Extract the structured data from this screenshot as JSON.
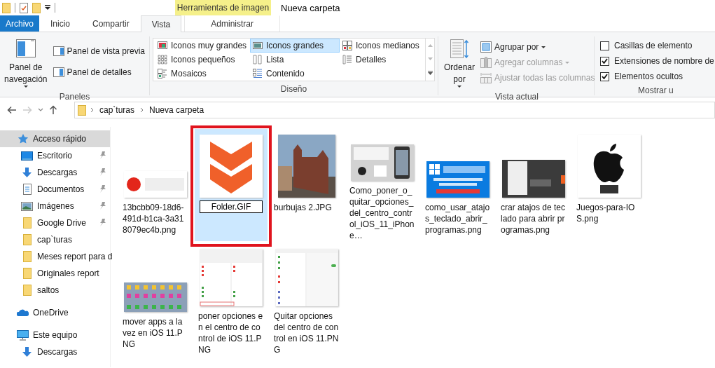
{
  "window": {
    "title": "Nueva carpeta"
  },
  "contextual_tab_group": {
    "title": "Herramientas de imagen"
  },
  "tabs": [
    {
      "label": "Archivo",
      "kind": "file",
      "selected": false
    },
    {
      "label": "Inicio",
      "kind": "normal",
      "selected": false
    },
    {
      "label": "Compartir",
      "kind": "normal",
      "selected": false
    },
    {
      "label": "Vista",
      "kind": "normal",
      "selected": true
    },
    {
      "label": "Administrar",
      "kind": "contextual",
      "selected": false
    }
  ],
  "ribbon_groups": [
    {
      "kind": "panes",
      "label": "Paneles",
      "large_button": "Panel de navegación",
      "buttons": [
        "Panel de vista previa",
        "Panel de detalles"
      ]
    },
    {
      "kind": "layout",
      "label": "Diseño",
      "options": [
        {
          "label": "Iconos muy grandes",
          "selected": false
        },
        {
          "label": "Iconos grandes",
          "selected": true
        },
        {
          "label": "Iconos medianos",
          "selected": false
        },
        {
          "label": "Iconos pequeños",
          "selected": false
        },
        {
          "label": "Lista",
          "selected": false
        },
        {
          "label": "Detalles",
          "selected": false
        },
        {
          "label": "Mosaicos",
          "selected": false
        },
        {
          "label": "Contenido",
          "selected": false
        }
      ]
    },
    {
      "kind": "current_view",
      "label": "Vista actual",
      "large_button": "Ordenar por",
      "buttons": [
        {
          "label": "Agrupar por",
          "disabled": false,
          "dropdown": true
        },
        {
          "label": "Agregar columnas",
          "disabled": true,
          "dropdown": true
        },
        {
          "label": "Ajustar todas las columnas",
          "disabled": true,
          "dropdown": false
        }
      ]
    },
    {
      "kind": "show_hide",
      "label": "Mostrar u",
      "checkboxes": [
        {
          "label": "Casillas de elemento",
          "checked": false
        },
        {
          "label": "Extensiones de nombre de",
          "checked": true
        },
        {
          "label": "Elementos ocultos",
          "checked": true
        }
      ]
    }
  ],
  "address_bar": {
    "path": [
      "cap`turas",
      "Nueva carpeta"
    ]
  },
  "navigation_pane": {
    "items": [
      {
        "label": "Acceso rápido",
        "kind": "star",
        "selected": true,
        "children": [
          {
            "label": "Escritorio",
            "kind": "desktop",
            "pinned": true,
            "selected": false
          },
          {
            "label": "Descargas",
            "kind": "download",
            "pinned": true,
            "selected": false
          },
          {
            "label": "Documentos",
            "kind": "document",
            "pinned": true,
            "selected": false
          },
          {
            "label": "Imágenes",
            "kind": "pictures",
            "pinned": true,
            "selected": false
          },
          {
            "label": "Google Drive",
            "kind": "folder",
            "pinned": true,
            "selected": false
          },
          {
            "label": "cap`turas",
            "kind": "folder",
            "pinned": false,
            "selected": false
          },
          {
            "label": "Meses report para d",
            "kind": "folder",
            "pinned": false,
            "selected": false
          },
          {
            "label": "Originales report",
            "kind": "folder",
            "pinned": false,
            "selected": false
          },
          {
            "label": "saltos",
            "kind": "folder",
            "pinned": false,
            "selected": false
          }
        ]
      },
      {
        "label": "OneDrive",
        "kind": "cloud",
        "selected": false
      },
      {
        "label": "Este equipo",
        "kind": "computer",
        "selected": false,
        "children": [
          {
            "label": "Descargas",
            "kind": "download",
            "pinned": false,
            "selected": false
          }
        ]
      }
    ]
  },
  "files": [
    {
      "name": "13bcbb09-18d6-491d-b1ca-3a318079ec4b.png",
      "kind": "rec",
      "selected": false,
      "renaming": false,
      "highlighted": false
    },
    {
      "name": "Folder.GIF",
      "kind": "chevrons",
      "selected": true,
      "renaming": true,
      "highlighted": true
    },
    {
      "name": "burbujas 2.JPG",
      "kind": "photo",
      "selected": false,
      "renaming": false,
      "highlighted": false
    },
    {
      "name": "Como_poner_o_quitar_opciones_del_centro_control_iOS_11_iPhone…",
      "kind": "ios-card",
      "selected": false,
      "renaming": false,
      "highlighted": false
    },
    {
      "name": "como_usar_atajos_teclado_abrir_programas.png",
      "kind": "blue-banner",
      "selected": false,
      "renaming": false,
      "highlighted": false
    },
    {
      "name": "crar atajos de teclado para abrir programas.png",
      "kind": "dark-screen",
      "selected": false,
      "renaming": false,
      "highlighted": false
    },
    {
      "name": "Juegos-para-IOS.png",
      "kind": "apple",
      "selected": false,
      "renaming": false,
      "highlighted": false
    },
    {
      "name": "mover apps a la vez en iOS 11.PNG",
      "kind": "app-grid",
      "selected": false,
      "renaming": false,
      "highlighted": false
    },
    {
      "name": "poner opciones en el centro de control de iOS 11.PNG",
      "kind": "settings-list",
      "selected": false,
      "renaming": false,
      "highlighted": false
    },
    {
      "name": "Quitar opciones del centro de control en iOS 11.PNG",
      "kind": "settings-split",
      "selected": false,
      "renaming": false,
      "highlighted": false
    }
  ]
}
